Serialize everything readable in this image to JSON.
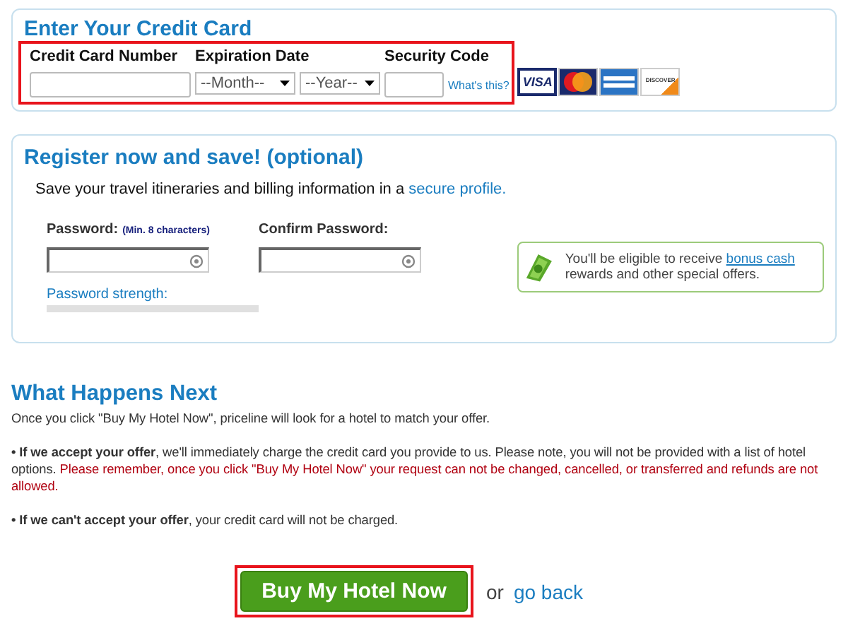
{
  "card_section": {
    "title": "Enter Your Credit Card",
    "highlighted": true,
    "fields": [
      {
        "kind": "text",
        "label": "Credit Card Number"
      },
      {
        "kind": "expiry",
        "label": "Expiration Date",
        "month": "--Month--",
        "year": "--Year--"
      },
      {
        "kind": "cvv",
        "label": "Security Code",
        "link": "What's this?"
      }
    ],
    "cards": [
      {
        "kind": "visa",
        "label": "VISA"
      },
      {
        "kind": "mastercard"
      },
      {
        "kind": "amex"
      },
      {
        "kind": "discover",
        "label": "DISCOVER"
      }
    ]
  },
  "register": {
    "title": "Register now and save! (optional)",
    "intro": "Save your travel itineraries and billing information in a",
    "intro_link": "secure profile.",
    "password": {
      "label": "Password:",
      "hint": "(Min. 8 characters)"
    },
    "confirm": {
      "label": "Confirm Password:"
    },
    "strength": {
      "label": "Password strength:",
      "level": 0
    },
    "promo": {
      "text": "You'll be eligible to receive",
      "link": "bonus cash",
      "rest": "rewards and other special offers."
    }
  },
  "next": {
    "title": "What Happens Next",
    "intro": "Once you click \"Buy My Hotel Now\", priceline will look for a hotel to match your offer.",
    "bullets": [
      {
        "bold": "• If we accept your offer",
        "text": ", we'll immediately charge the credit card you provide to us. Please note, you will not be provided with a list of hotel options.",
        "warning": "Please remember, once you click \"Buy My Hotel Now\" your request can not be changed, cancelled, or transferred and refunds are not allowed."
      },
      {
        "bold": "• If we can't accept your offer",
        "text": ", your credit card will not be charged."
      }
    ]
  },
  "actions": {
    "button": "Buy My Hotel Now",
    "highlighted": true,
    "or": "or",
    "back": "go back"
  }
}
